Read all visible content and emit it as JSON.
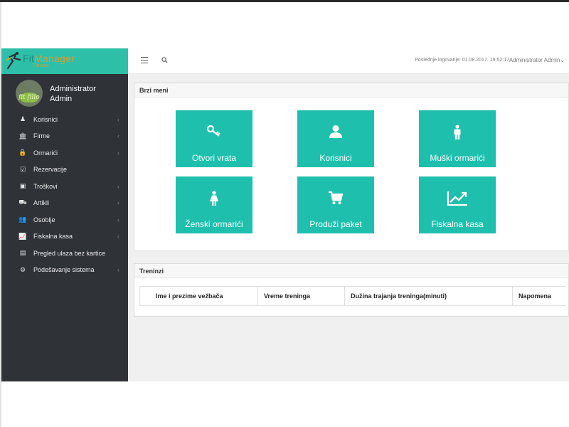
{
  "brand": {
    "name_prefix": "Fit",
    "name_main": "Manager",
    "subtitle": "Fitness"
  },
  "user": {
    "line1": "Administrator",
    "line2": "Admin",
    "avatar_text": "fit filio"
  },
  "header": {
    "last_login": "Poslednje logovanje: 01.08.2017. 19:52:17",
    "user_menu": "Administrator Admin",
    "user_menu_caret": "⌄"
  },
  "sidebar": {
    "items": [
      {
        "label": "Korisnici",
        "icon": "user-icon",
        "glyph": "♟",
        "chevron": true
      },
      {
        "label": "Firme",
        "icon": "bank-icon",
        "glyph": "🏛",
        "chevron": true
      },
      {
        "label": "Ormarići",
        "icon": "lock-icon",
        "glyph": "🔒",
        "chevron": true
      },
      {
        "label": "Rezervacije",
        "icon": "checkbox-icon",
        "glyph": "☑",
        "chevron": false
      },
      {
        "label": "Troškovi",
        "icon": "money-icon",
        "glyph": "▣",
        "chevron": true
      },
      {
        "label": "Artikli",
        "icon": "cart-icon",
        "glyph": "⛟",
        "chevron": true
      },
      {
        "label": "Osoblje",
        "icon": "users-icon",
        "glyph": "👥",
        "chevron": true
      },
      {
        "label": "Fiskalna kasa",
        "icon": "chart-line-icon",
        "glyph": "📈",
        "chevron": true
      },
      {
        "label": "Pregled ulaza bez kartice",
        "icon": "file-icon",
        "glyph": "▤",
        "chevron": false
      },
      {
        "label": "Podešavanje sistema",
        "icon": "cogs-icon",
        "glyph": "⚙",
        "chevron": true
      }
    ],
    "chevron_glyph": "‹"
  },
  "quick_menu": {
    "title": "Brzi meni",
    "tiles": [
      {
        "label": "Otvori vrata",
        "icon": "key-icon"
      },
      {
        "label": "Korisnici",
        "icon": "user-icon"
      },
      {
        "label": "Muški ormarići",
        "icon": "male-icon"
      },
      {
        "label": "Ženski ormarići",
        "icon": "female-icon"
      },
      {
        "label": "Produži paket",
        "icon": "cart-icon"
      },
      {
        "label": "Fiskalna kasa",
        "icon": "chart-line-icon"
      }
    ]
  },
  "trainings": {
    "title": "Treninzi",
    "columns": [
      "Ime i prezime vežbača",
      "Vreme treninga",
      "Dužina trajanja treninga(minuti)",
      "Napomena"
    ]
  },
  "colors": {
    "accent": "#1fbfad",
    "brand_bar": "#2ebfa9",
    "sidebar_bg": "#2f3236",
    "content_bg": "#f0f0f1"
  }
}
